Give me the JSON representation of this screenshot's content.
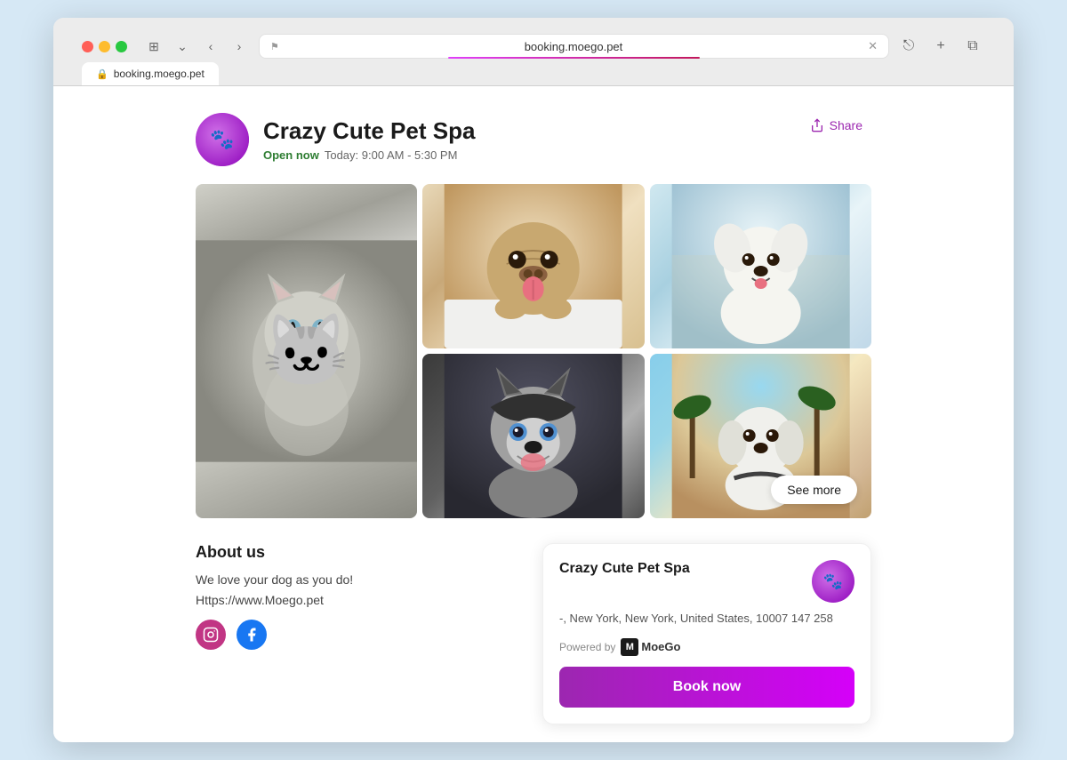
{
  "browser": {
    "url": "booking.moego.pet",
    "tab_title": "booking.moego.pet"
  },
  "business": {
    "name": "Crazy Cute Pet Spa",
    "status": "Open now",
    "hours": "Today: 9:00 AM - 5:30 PM",
    "share_label": "Share",
    "address": "-, New York, New York, United States, 10007\n147 258"
  },
  "about": {
    "title": "About us",
    "description": "We love your dog as you do!",
    "website": "Https://www.Moego.pet"
  },
  "gallery": {
    "see_more_label": "See more"
  },
  "card": {
    "powered_by": "Powered by",
    "brand": "MoeGo",
    "book_label": "Book now"
  }
}
